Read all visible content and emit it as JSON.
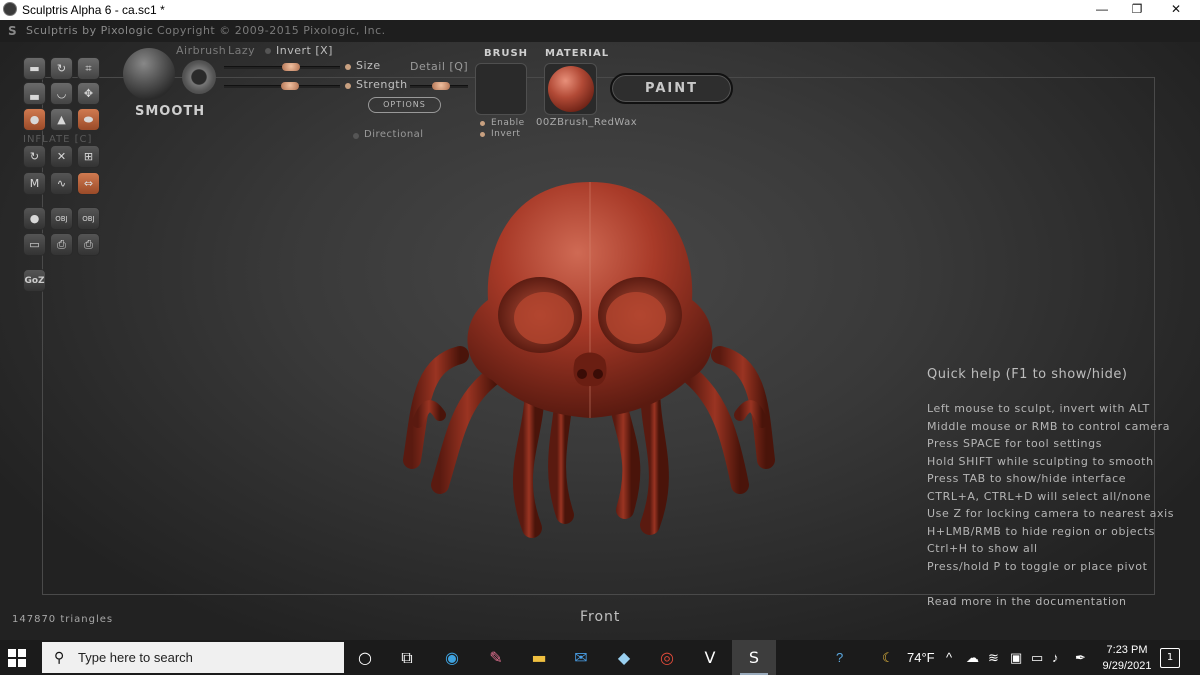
{
  "window": {
    "title": "Sculptris Alpha 6 - ca.sc1 *",
    "minimize_glyph": "—",
    "maximize_glyph": "❐",
    "close_glyph": "✕"
  },
  "app_header": {
    "logo_glyph": "S",
    "brand": "Sculptris by Pixologic",
    "copyright": "Copyright © 2009-2015 Pixologic, Inc."
  },
  "tools": {
    "inflate_label": "INFLATE [C]",
    "goz_label": "GoZ",
    "obj_label": "OBJ",
    "m_label": "M"
  },
  "brush_panel": {
    "airbrush": "Airbrush",
    "lazy": "Lazy",
    "invert": "Invert [X]",
    "size": "Size",
    "strength": "Strength",
    "detail": "Detail [Q]",
    "options": "OPTIONS",
    "directional": "Directional",
    "brush_name": "SMOOTH",
    "size_level": 0.62,
    "strength_level": 0.55,
    "detail_level": 0.5
  },
  "brush_section": {
    "header": "BRUSH",
    "enable": "Enable",
    "invert": "Invert"
  },
  "material_section": {
    "header": "MATERIAL",
    "name": "00ZBrush_RedWax"
  },
  "paint_button": "PAINT",
  "quick_help": {
    "title": "Quick help (F1 to show/hide)",
    "lines": [
      "Left mouse to sculpt, invert with ALT",
      "Middle mouse or RMB to control camera",
      "Press SPACE for tool settings",
      "Hold SHIFT while sculpting to smooth",
      "Press TAB to show/hide interface",
      "CTRL+A, CTRL+D will select all/none",
      "Use Z for locking camera to nearest axis",
      "H+LMB/RMB to hide region or objects",
      "Ctrl+H to show all",
      "Press/hold P to toggle or place pivot"
    ],
    "footer": "Read more in the documentation"
  },
  "status": {
    "triangles": "147870 triangles",
    "view": "Front"
  },
  "taskbar": {
    "search_placeholder": "Type here to search",
    "weather": "74°F",
    "time": "7:23 PM",
    "date": "9/29/2021",
    "notifications": "1"
  },
  "colors": {
    "model": "#a83a28",
    "accent_orange": "#c8683c"
  }
}
